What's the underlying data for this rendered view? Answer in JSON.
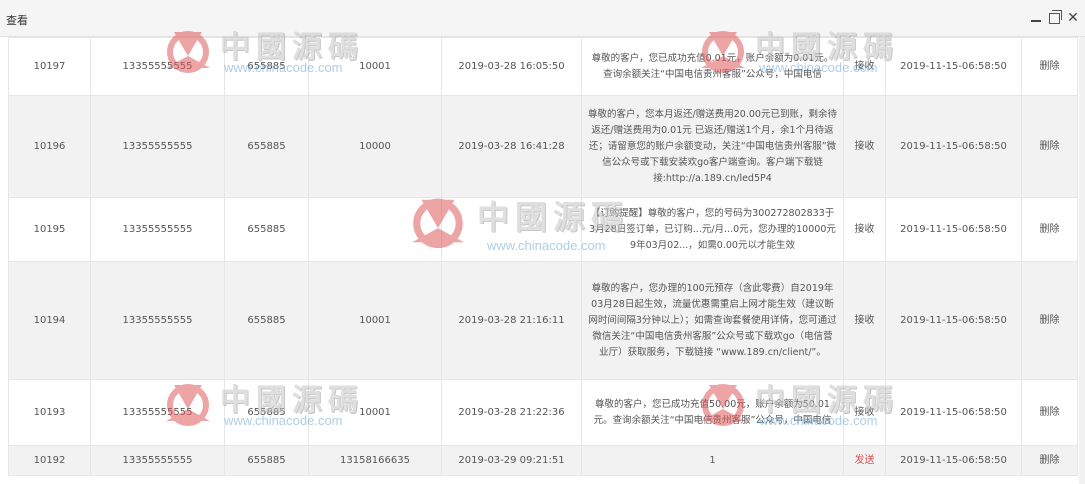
{
  "window": {
    "title": "查看",
    "minimize_icon": "minimize-icon",
    "maximize_icon": "maximize-icon",
    "close_icon": "close-icon"
  },
  "colors": {
    "send": "#d9534f",
    "row_alt": "#f2f2f2",
    "watermark_url": "#6aa7d6",
    "watermark_logo": "#e05a5a"
  },
  "watermark": {
    "text": "中國源碼",
    "url": "www.chinacode.com"
  },
  "rows": [
    {
      "id": "10197",
      "phone": "13355555555",
      "code": "655885",
      "port": "10001",
      "time": "2019-03-28 16:05:50",
      "message": "尊敬的客户，您已成功充值0.01元，账户余额为0.01元。查询余额关注“中国电信贵州客服”公众号，中国电信",
      "type": "接收",
      "created": "2019-11-15-06:58:50",
      "action": "删除"
    },
    {
      "id": "10196",
      "phone": "13355555555",
      "code": "655885",
      "port": "10000",
      "time": "2019-03-28 16:41:28",
      "message": "尊敬的客户，您本月返还/赠送费用20.00元已到账，剩余待返还/赠送费用为0.01元 已返还/赠送1个月，余1个月待返还；请留意您的账户余额变动，关注“中国电信贵州客服”微信公众号或下载安装欢go客户端查询。客户端下载链接:http://a.189.cn/led5P4",
      "type": "接收",
      "created": "2019-11-15-06:58:50",
      "action": "删除"
    },
    {
      "id": "10195",
      "phone": "13355555555",
      "code": "655885",
      "port": "",
      "time": "",
      "message": "【订购提醒】尊敬的客户，您的号码为300272802833于3月28日签订单，已订购...元/月...0元，您办理的10000元9年03月02...，如需0.00元以才能生效",
      "type": "接收",
      "created": "2019-11-15-06:58:50",
      "action": "删除"
    },
    {
      "id": "10194",
      "phone": "13355555555",
      "code": "655885",
      "port": "10001",
      "time": "2019-03-28 21:16:11",
      "message": "尊敬的客户，您办理的100元预存（含此零费）自2019年03月28日起生效，流量优惠需重启上网才能生效（建议断网时间间隔3分钟以上）；如需查询套餐使用详情，您可通过微信关注“中国电信贵州客服”公众号或下载欢go（电信营业厅）获取服务，下载链接 “www.189.cn/client/”。",
      "type": "接收",
      "created": "2019-11-15-06:58:50",
      "action": "删除"
    },
    {
      "id": "10193",
      "phone": "13355555555",
      "code": "655885",
      "port": "10001",
      "time": "2019-03-28 21:22:36",
      "message": "尊敬的客户，您已成功充值50.00元，账户余额为50.01元。查询余额关注“中国电信贵州客服”公众号，中国电信",
      "type": "接收",
      "created": "2019-11-15-06:58:50",
      "action": "删除"
    },
    {
      "id": "10192",
      "phone": "13355555555",
      "code": "655885",
      "port": "13158166635",
      "time": "2019-03-29 09:21:51",
      "message": "1",
      "type": "发送",
      "created": "2019-11-15-06:58:50",
      "action": "删除"
    }
  ]
}
